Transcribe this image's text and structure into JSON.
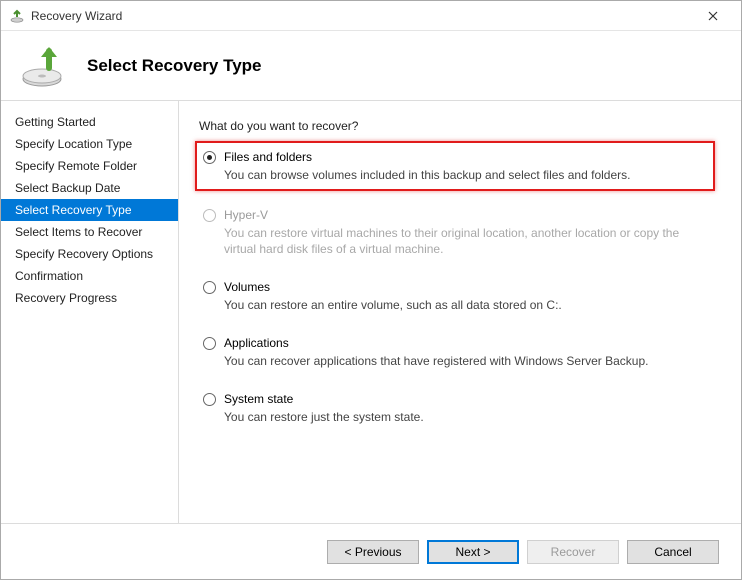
{
  "window": {
    "title": "Recovery Wizard"
  },
  "header": {
    "title": "Select Recovery Type"
  },
  "sidebar": {
    "steps": [
      "Getting Started",
      "Specify Location Type",
      "Specify Remote Folder",
      "Select Backup Date",
      "Select Recovery Type",
      "Select Items to Recover",
      "Specify Recovery Options",
      "Confirmation",
      "Recovery Progress"
    ],
    "active_index": 4
  },
  "content": {
    "prompt": "What do you want to recover?",
    "options": [
      {
        "id": "files-folders",
        "title": "Files and folders",
        "desc": "You can browse volumes included in this backup and select files and folders.",
        "checked": true,
        "disabled": false,
        "highlighted": true
      },
      {
        "id": "hyperv",
        "title": "Hyper-V",
        "desc": "You can restore virtual machines to their original location, another location or copy the virtual hard disk files of a virtual machine.",
        "checked": false,
        "disabled": true,
        "highlighted": false
      },
      {
        "id": "volumes",
        "title": "Volumes",
        "desc": "You can restore an entire volume, such as all data stored on C:.",
        "checked": false,
        "disabled": false,
        "highlighted": false
      },
      {
        "id": "applications",
        "title": "Applications",
        "desc": "You can recover applications that have registered with Windows Server Backup.",
        "checked": false,
        "disabled": false,
        "highlighted": false
      },
      {
        "id": "system-state",
        "title": "System state",
        "desc": "You can restore just the system state.",
        "checked": false,
        "disabled": false,
        "highlighted": false
      }
    ]
  },
  "footer": {
    "previous": "< Previous",
    "next": "Next >",
    "recover": "Recover",
    "cancel": "Cancel"
  }
}
